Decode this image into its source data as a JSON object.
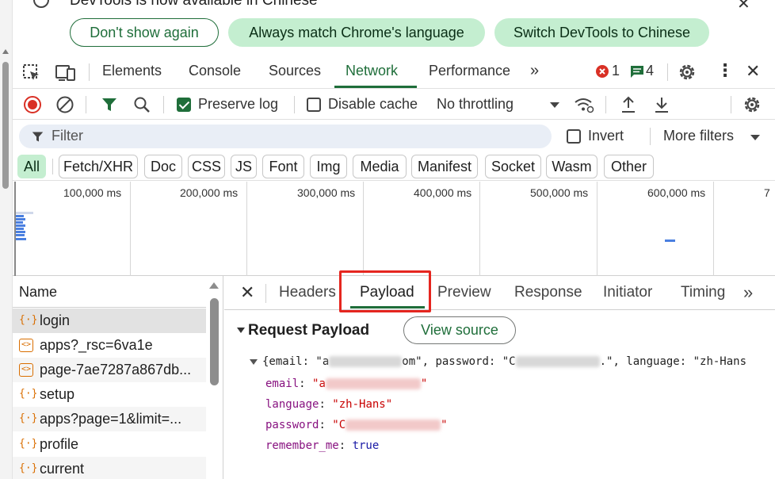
{
  "banner": {
    "message": "DevTools is now available in Chinese",
    "dont_show": "Don't show again",
    "always_match": "Always match Chrome's language",
    "switch_chinese": "Switch DevTools to Chinese"
  },
  "main_tabs": {
    "items": [
      "Elements",
      "Console",
      "Sources",
      "Network",
      "Performance"
    ],
    "active": "Network",
    "error_count": "1",
    "message_count": "4"
  },
  "network_toolbar": {
    "preserve_log": "Preserve log",
    "preserve_log_checked": true,
    "disable_cache": "Disable cache",
    "disable_cache_checked": false,
    "throttling": "No throttling"
  },
  "filter_bar": {
    "placeholder": "Filter",
    "invert": "Invert",
    "more_filters": "More filters"
  },
  "type_filters": [
    "All",
    "Fetch/XHR",
    "Doc",
    "CSS",
    "JS",
    "Font",
    "Img",
    "Media",
    "Manifest",
    "Socket",
    "Wasm",
    "Other"
  ],
  "active_type_filter": "All",
  "overview": {
    "tick_labels": [
      "100,000 ms",
      "200,000 ms",
      "300,000 ms",
      "400,000 ms",
      "500,000 ms",
      "600,000 ms",
      "7"
    ]
  },
  "request_list": {
    "header": "Name",
    "rows": [
      {
        "name": "login",
        "type": "fetch",
        "selected": true
      },
      {
        "name": "apps?_rsc=6va1e",
        "type": "doc",
        "selected": false
      },
      {
        "name": "page-7ae7287a867db...",
        "type": "doc",
        "selected": false
      },
      {
        "name": "setup",
        "type": "fetch",
        "selected": false
      },
      {
        "name": "apps?page=1&limit=...",
        "type": "fetch",
        "selected": false
      },
      {
        "name": "profile",
        "type": "fetch",
        "selected": false
      },
      {
        "name": "current",
        "type": "fetch",
        "selected": false
      }
    ]
  },
  "detail": {
    "tabs": [
      "Headers",
      "Payload",
      "Preview",
      "Response",
      "Initiator",
      "Timing"
    ],
    "active_tab": "Payload",
    "section_title": "Request Payload",
    "view_source": "View source",
    "summary_prefix": "{email: \"a",
    "summary_mid1": "om\", password: \"C",
    "summary_mid2": ".\", language: \"zh-Hans",
    "email_key": "email",
    "email_val_start": "\"a",
    "email_val_end": "\"",
    "language_key": "language",
    "language_val": "\"zh-Hans\"",
    "password_key": "password",
    "password_val_start": "\"C",
    "password_val_end": "\"",
    "remember_key": "remember_me",
    "remember_val": "true"
  },
  "colors": {
    "accent_green": "#1f6e3a",
    "chip_green": "#c4eed0",
    "highlight_red": "#e5261f",
    "error_red": "#d93025"
  }
}
